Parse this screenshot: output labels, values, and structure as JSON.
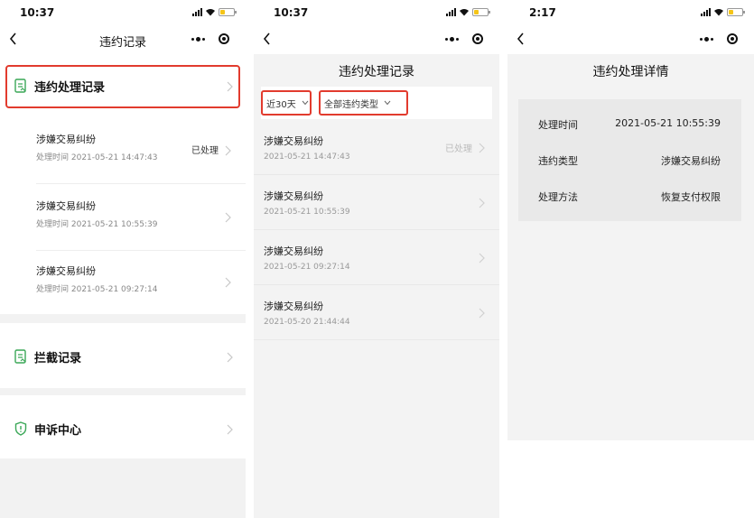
{
  "colors": {
    "highlight": "#e23b2e",
    "icon_green": "#3aa757",
    "page_gray": "#f3f3f3",
    "card_gray": "#e9e9e9"
  },
  "panel1": {
    "time": "10:37",
    "title": "违约记录",
    "menu": {
      "violation_records": "违约处理记录",
      "intercept_records": "拦截记录",
      "appeal_center": "申诉中心"
    },
    "records": [
      {
        "title": "涉嫌交易纠纷",
        "subtitle": "处理时间 2021-05-21 14:47:43",
        "status": "已处理"
      },
      {
        "title": "涉嫌交易纠纷",
        "subtitle": "处理时间 2021-05-21 10:55:39",
        "status": ""
      },
      {
        "title": "涉嫌交易纠纷",
        "subtitle": "处理时间 2021-05-21 09:27:14",
        "status": ""
      }
    ]
  },
  "panel2": {
    "time": "10:37",
    "title": "违约处理记录",
    "filters": {
      "period": "近30天",
      "type": "全部违约类型"
    },
    "records": [
      {
        "title": "涉嫌交易纠纷",
        "date": "2021-05-21 14:47:43",
        "status": "已处理"
      },
      {
        "title": "涉嫌交易纠纷",
        "date": "2021-05-21 10:55:39",
        "status": ""
      },
      {
        "title": "涉嫌交易纠纷",
        "date": "2021-05-21 09:27:14",
        "status": ""
      },
      {
        "title": "涉嫌交易纠纷",
        "date": "2021-05-20 21:44:44",
        "status": ""
      }
    ]
  },
  "panel3": {
    "time": "2:17",
    "title": "违约处理详情",
    "details": [
      {
        "key": "处理时间",
        "value": "2021-05-21 10:55:39"
      },
      {
        "key": "违约类型",
        "value": "涉嫌交易纠纷"
      },
      {
        "key": "处理方法",
        "value": "恢复支付权限"
      }
    ]
  }
}
